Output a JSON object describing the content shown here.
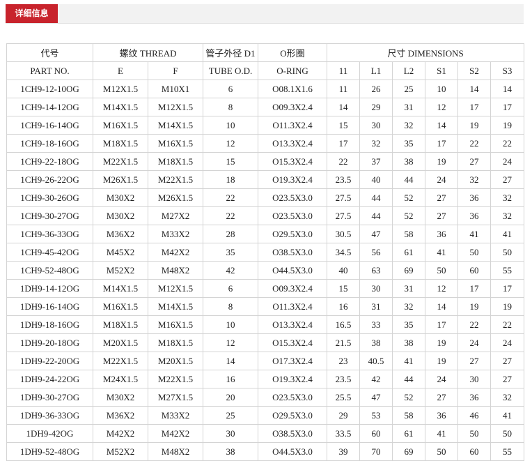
{
  "header": {
    "tab_label": "详细信息"
  },
  "table": {
    "group_headers": {
      "code": "代号",
      "thread": "螺纹 THREAD",
      "tube": "管子外径 D1",
      "oring": "O形圈",
      "dims": "尺寸 DIMENSIONS"
    },
    "sub_headers": [
      "PART NO.",
      "E",
      "F",
      "TUBE O.D.",
      "O-RING",
      "11",
      "L1",
      "L2",
      "S1",
      "S2",
      "S3"
    ],
    "rows": [
      [
        "1CH9-12-10OG",
        "M12X1.5",
        "M10X1",
        "6",
        "O08.1X1.6",
        "11",
        "26",
        "25",
        "10",
        "14",
        "14"
      ],
      [
        "1CH9-14-12OG",
        "M14X1.5",
        "M12X1.5",
        "8",
        "O09.3X2.4",
        "14",
        "29",
        "31",
        "12",
        "17",
        "17"
      ],
      [
        "1CH9-16-14OG",
        "M16X1.5",
        "M14X1.5",
        "10",
        "O11.3X2.4",
        "15",
        "30",
        "32",
        "14",
        "19",
        "19"
      ],
      [
        "1CH9-18-16OG",
        "M18X1.5",
        "M16X1.5",
        "12",
        "O13.3X2.4",
        "17",
        "32",
        "35",
        "17",
        "22",
        "22"
      ],
      [
        "1CH9-22-18OG",
        "M22X1.5",
        "M18X1.5",
        "15",
        "O15.3X2.4",
        "22",
        "37",
        "38",
        "19",
        "27",
        "24"
      ],
      [
        "1CH9-26-22OG",
        "M26X1.5",
        "M22X1.5",
        "18",
        "O19.3X2.4",
        "23.5",
        "40",
        "44",
        "24",
        "32",
        "27"
      ],
      [
        "1CH9-30-26OG",
        "M30X2",
        "M26X1.5",
        "22",
        "O23.5X3.0",
        "27.5",
        "44",
        "52",
        "27",
        "36",
        "32"
      ],
      [
        "1CH9-30-27OG",
        "M30X2",
        "M27X2",
        "22",
        "O23.5X3.0",
        "27.5",
        "44",
        "52",
        "27",
        "36",
        "32"
      ],
      [
        "1CH9-36-33OG",
        "M36X2",
        "M33X2",
        "28",
        "O29.5X3.0",
        "30.5",
        "47",
        "58",
        "36",
        "41",
        "41"
      ],
      [
        "1CH9-45-42OG",
        "M45X2",
        "M42X2",
        "35",
        "O38.5X3.0",
        "34.5",
        "56",
        "61",
        "41",
        "50",
        "50"
      ],
      [
        "1CH9-52-48OG",
        "M52X2",
        "M48X2",
        "42",
        "O44.5X3.0",
        "40",
        "63",
        "69",
        "50",
        "60",
        "55"
      ],
      [
        "1DH9-14-12OG",
        "M14X1.5",
        "M12X1.5",
        "6",
        "O09.3X2.4",
        "15",
        "30",
        "31",
        "12",
        "17",
        "17"
      ],
      [
        "1DH9-16-14OG",
        "M16X1.5",
        "M14X1.5",
        "8",
        "O11.3X2.4",
        "16",
        "31",
        "32",
        "14",
        "19",
        "19"
      ],
      [
        "1DH9-18-16OG",
        "M18X1.5",
        "M16X1.5",
        "10",
        "O13.3X2.4",
        "16.5",
        "33",
        "35",
        "17",
        "22",
        "22"
      ],
      [
        "1DH9-20-18OG",
        "M20X1.5",
        "M18X1.5",
        "12",
        "O15.3X2.4",
        "21.5",
        "38",
        "38",
        "19",
        "24",
        "24"
      ],
      [
        "1DH9-22-20OG",
        "M22X1.5",
        "M20X1.5",
        "14",
        "O17.3X2.4",
        "23",
        "40.5",
        "41",
        "19",
        "27",
        "27"
      ],
      [
        "1DH9-24-22OG",
        "M24X1.5",
        "M22X1.5",
        "16",
        "O19.3X2.4",
        "23.5",
        "42",
        "44",
        "24",
        "30",
        "27"
      ],
      [
        "1DH9-30-27OG",
        "M30X2",
        "M27X1.5",
        "20",
        "O23.5X3.0",
        "25.5",
        "47",
        "52",
        "27",
        "36",
        "32"
      ],
      [
        "1DH9-36-33OG",
        "M36X2",
        "M33X2",
        "25",
        "O29.5X3.0",
        "29",
        "53",
        "58",
        "36",
        "46",
        "41"
      ],
      [
        "1DH9-42OG",
        "M42X2",
        "M42X2",
        "30",
        "O38.5X3.0",
        "33.5",
        "60",
        "61",
        "41",
        "50",
        "50"
      ],
      [
        "1DH9-52-48OG",
        "M52X2",
        "M48X2",
        "38",
        "O44.5X3.0",
        "39",
        "70",
        "69",
        "50",
        "60",
        "55"
      ]
    ]
  },
  "colors": {
    "tab_bg": "#c8232c",
    "tab_text": "#ffffff",
    "border": "#d4d4d4"
  }
}
